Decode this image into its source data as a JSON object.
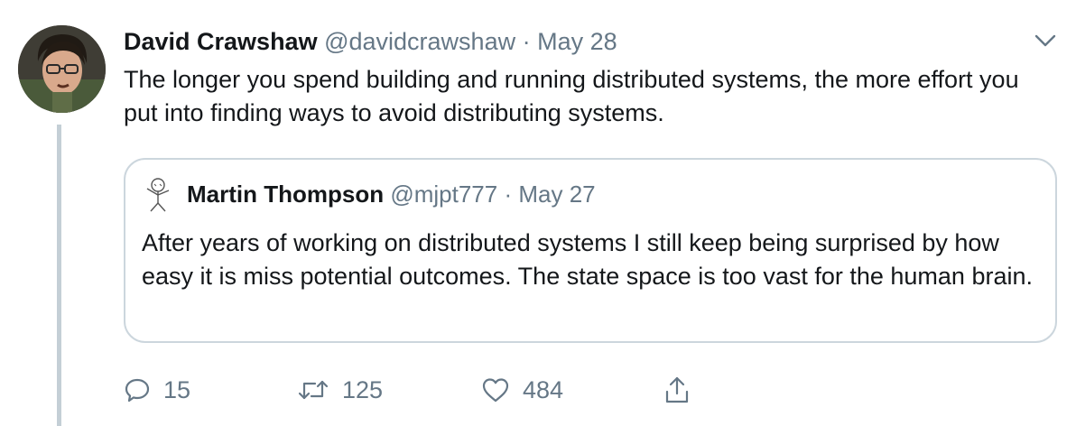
{
  "tweet": {
    "display_name": "David Crawshaw",
    "handle": "@davidcrawshaw",
    "separator": "·",
    "date": "May 28",
    "text": "The longer you spend building and running distributed systems, the more effort you put into finding ways to avoid distributing systems."
  },
  "quoted_tweet": {
    "display_name": "Martin Thompson",
    "handle": "@mjpt777",
    "separator": "·",
    "date": "May 27",
    "text": "After years of working on distributed systems I still keep being surprised by how easy it is miss potential outcomes. The state space is too vast for the human brain."
  },
  "actions": {
    "reply_count": "15",
    "retweet_count": "125",
    "like_count": "484"
  },
  "icons": {
    "reply": "reply-icon",
    "retweet": "retweet-icon",
    "like": "heart-icon",
    "share": "share-icon",
    "menu": "chevron-down-icon"
  },
  "colors": {
    "text": "#14171a",
    "muted": "#657786",
    "border": "#ccd6dd",
    "thread_line": "#c4cfd6"
  }
}
